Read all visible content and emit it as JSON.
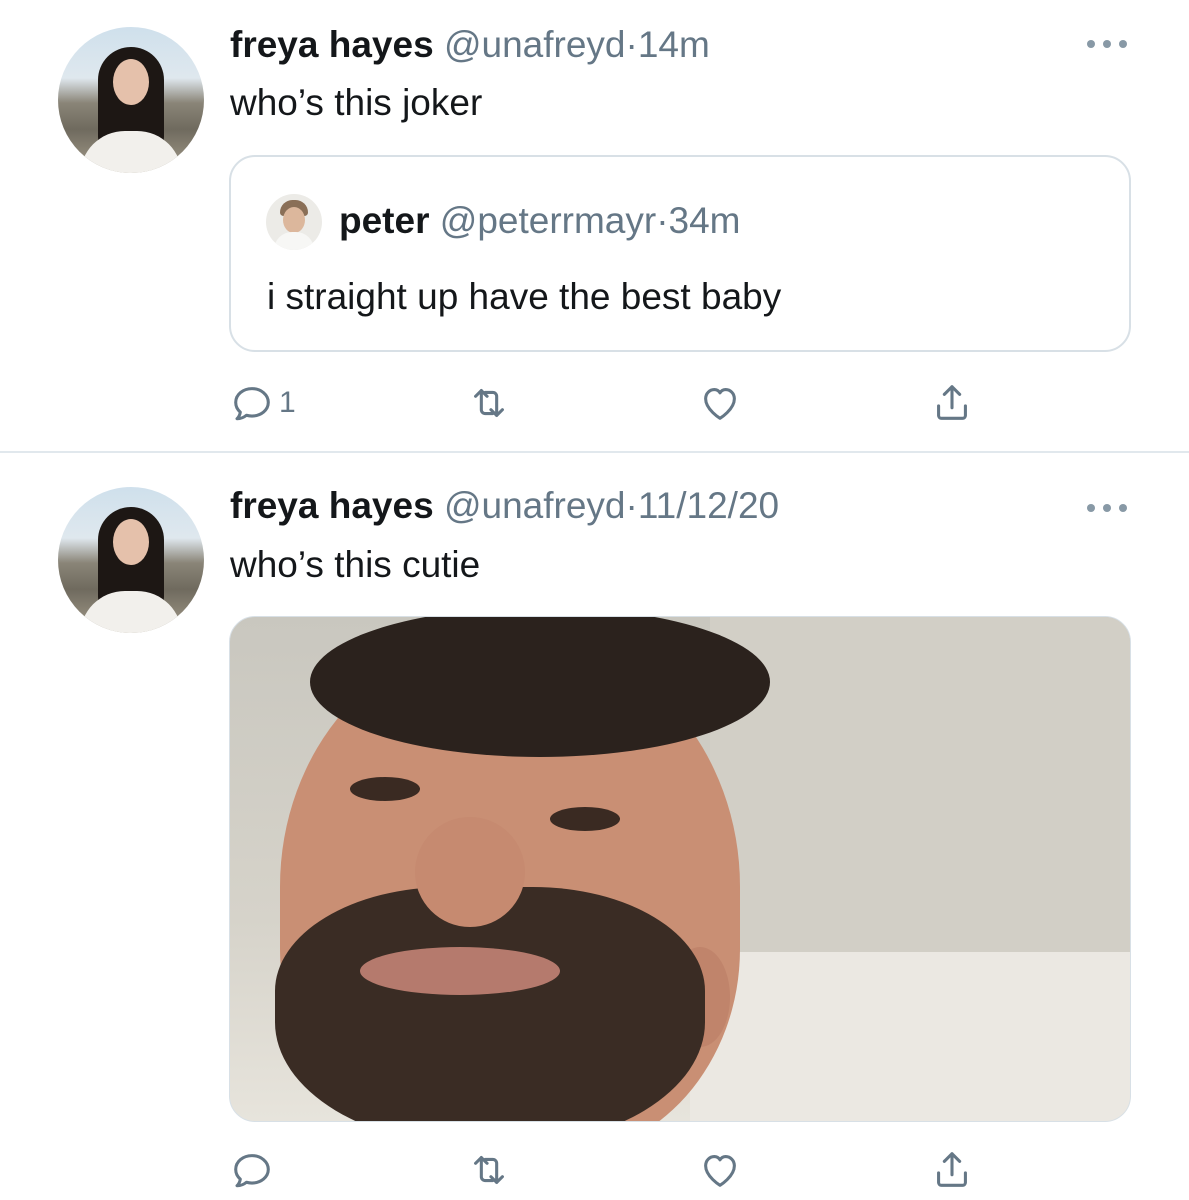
{
  "tweets": [
    {
      "display_name": "freya hayes",
      "handle": "@unafreyd",
      "separator": "·",
      "time": "14m",
      "text": "who’s this joker",
      "quoted": {
        "display_name": "peter",
        "handle": "@peterrmayr",
        "separator": "·",
        "time": "34m",
        "text": "i straight up have the best baby"
      },
      "reply_count": "1"
    },
    {
      "display_name": "freya hayes",
      "handle": "@unafreyd",
      "separator": "·",
      "time": "11/12/20",
      "text": "who’s this cutie",
      "reply_count": ""
    }
  ],
  "icons": {
    "more": "more-icon",
    "reply": "reply-icon",
    "retweet": "retweet-icon",
    "like": "heart-icon",
    "share": "share-icon"
  },
  "colors": {
    "text": "#14171a",
    "secondary": "#657786",
    "icon": "#657786",
    "border": "#d8e0e6",
    "divider": "#e1e8ed"
  }
}
